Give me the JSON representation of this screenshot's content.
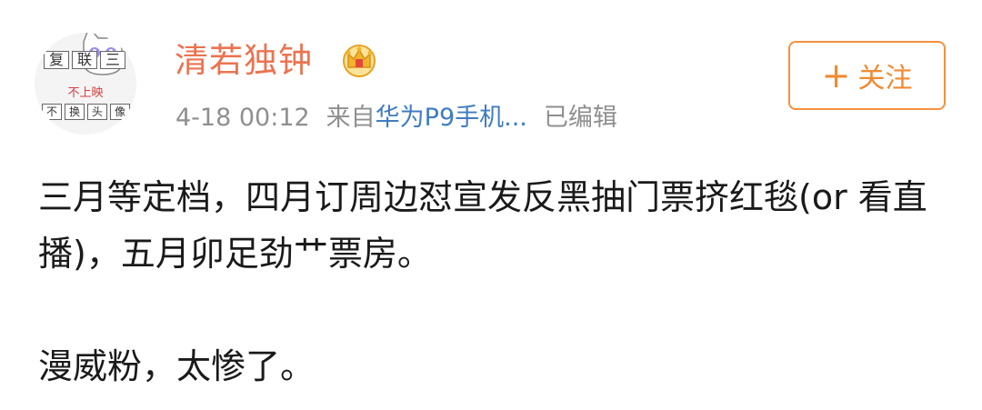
{
  "avatar": {
    "top_chars": [
      "复",
      "联",
      "三"
    ],
    "middle_text": "不上映",
    "bottom_chars": [
      "不",
      "换",
      "头",
      "像"
    ]
  },
  "user": {
    "name": "清若独钟",
    "badge_icon": "crown-vip-icon"
  },
  "meta": {
    "timestamp": "4-18 00:12",
    "source_prefix": "来自",
    "source_device": "华为P9手机...",
    "edited": "已编辑"
  },
  "follow_button": {
    "plus": "+",
    "label": "关注",
    "color": "#f08a31"
  },
  "post": {
    "paragraph1": "三月等定档，四月订周边怼宣发反黑抽门票挤红毯(or 看直播)，五月卯足劲艹票房。",
    "paragraph2": "漫威粉，太惨了。"
  },
  "colors": {
    "username": "#eb7350",
    "link": "#3f7cc1",
    "meta": "#8f8f8f",
    "follow_border": "#f6913d"
  }
}
